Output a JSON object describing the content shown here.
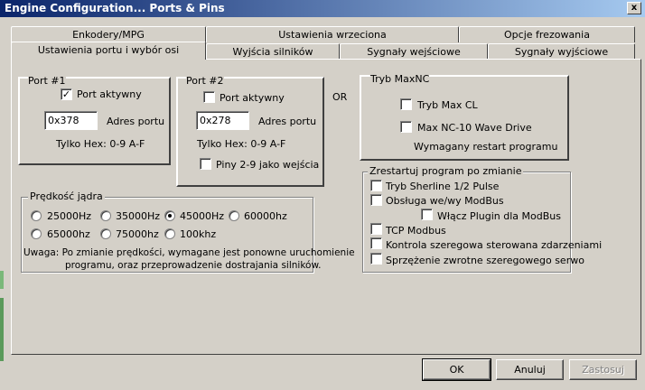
{
  "window": {
    "title": "Engine Configuration... Ports & Pins",
    "close_label": "x"
  },
  "tabs": {
    "back": [
      "Enkodery/MPG",
      "Ustawienia wrzeciona",
      "Opcje frezowania"
    ],
    "front": [
      "Ustawienia portu i wybór osi",
      "Wyjścia silników",
      "Sygnały wejściowe",
      "Sygnały wyjściowe"
    ]
  },
  "port1": {
    "title": "Port #1",
    "active_label": "Port aktywny",
    "active_checked": true,
    "address": "0x378",
    "address_label": "Adres portu",
    "hex_note": "Tylko Hex: 0-9 A-F"
  },
  "port2": {
    "title": "Port #2",
    "active_label": "Port aktywny",
    "active_checked": false,
    "address": "0x278",
    "address_label": "Adres portu",
    "hex_note": "Tylko Hex: 0-9 A-F",
    "pins_label": "Piny 2-9 jako wejścia",
    "pins_checked": false
  },
  "or_label": "OR",
  "maxnc": {
    "title": "Tryb MaxNC",
    "cl_label": "Tryb Max CL",
    "wave_label": "Max NC-10 Wave Drive",
    "note": "Wymagany restart programu"
  },
  "kernel": {
    "title": "Prędkość jądra",
    "options": [
      "25000Hz",
      "35000Hz",
      "45000Hz",
      "60000hz",
      "65000hz",
      "75000hz",
      "100khz"
    ],
    "selected": "45000Hz",
    "note_line1": "Uwaga: Po zmianie prędkości, wymagane jest ponowne uruchomienie",
    "note_line2": "programu, oraz przeprowadzenie dostrajania silników."
  },
  "restart": {
    "title": "Zrestartuj program po zmianie",
    "sherline": "Tryb Sherline 1/2 Pulse",
    "modbus": "Obsługa we/wy ModBus",
    "modbus_plugin": "Włącz Plugin dla ModBus",
    "tcp": "TCP Modbus",
    "event_serial": "Kontrola szeregowa sterowana zdarzeniami",
    "servo_feedback": "Sprzężenie zwrotne  szeregowego serwo"
  },
  "buttons": {
    "ok": "OK",
    "cancel": "Anuluj",
    "apply": "Zastosuj"
  }
}
